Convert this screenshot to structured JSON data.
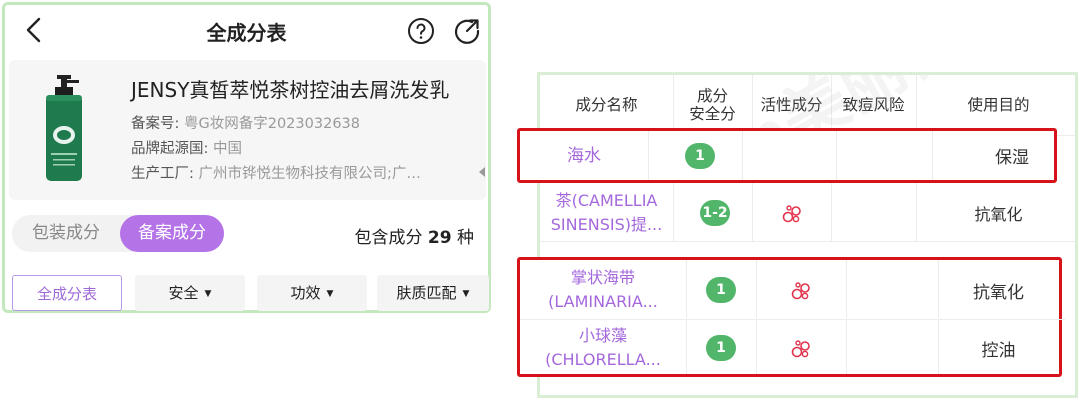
{
  "nav": {
    "title": "全成分表"
  },
  "product": {
    "name": "JENSY真皙萃悦茶树控油去屑洗发乳",
    "record_label": "备案号:",
    "record_value": "粤G妆网备字2023032638",
    "origin_label": "品牌起源国:",
    "origin_value": "中国",
    "factory_label": "生产工厂:",
    "factory_value": "广州市铧悦生物科技有限公司;广州..."
  },
  "tabs": {
    "packaging": "包装成分",
    "filing": "备案成分",
    "active": "filing"
  },
  "count": {
    "prefix": "包含成分",
    "number": "29",
    "suffix": "种"
  },
  "filters": {
    "all": "全成分表",
    "safety": "安全",
    "effect": "功效",
    "skin": "肤质匹配"
  },
  "table": {
    "headers": {
      "name": "成分名称",
      "safety_line1": "成分",
      "safety_line2": "安全分",
      "active": "活性成分",
      "risk": "致痘风险",
      "purpose": "使用目的"
    },
    "rows": [
      {
        "name_line1": "海水",
        "name_line2": "",
        "score": "1",
        "active": false,
        "risk": "",
        "purpose": "保湿"
      },
      {
        "name_line1": "茶(CAMELLIA",
        "name_line2": "SINENSIS)提...",
        "score": "1-2",
        "active": true,
        "risk": "",
        "purpose": "抗氧化"
      },
      {
        "name_line1": "掌状海带",
        "name_line2": "(LAMINARIA...",
        "score": "1",
        "active": true,
        "risk": "",
        "purpose": "抗氧化"
      },
      {
        "name_line1": "小球藻",
        "name_line2": "(CHLORELLA...",
        "score": "1",
        "active": true,
        "risk": "",
        "purpose": "控油"
      }
    ]
  },
  "colors": {
    "accent": "#b573e8",
    "score_green": "#52b66a",
    "highlight_red": "#d6131a",
    "panel_border": "#c4e8bd"
  }
}
